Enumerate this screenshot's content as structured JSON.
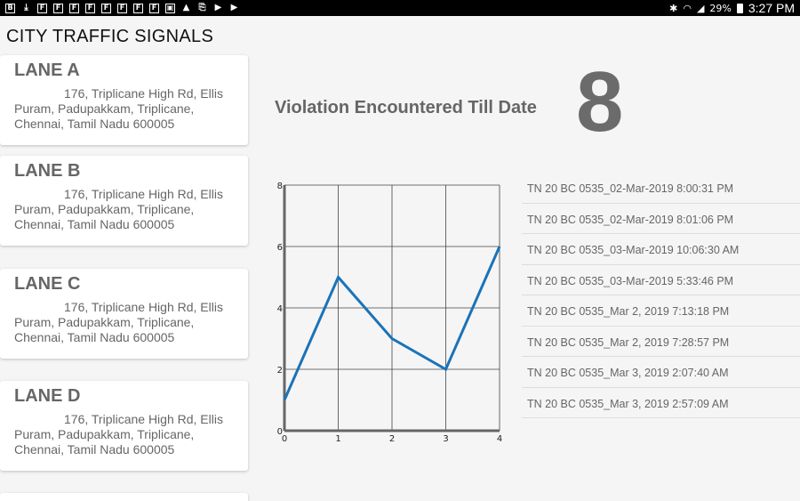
{
  "status_bar": {
    "notification_icons": [
      "b-icon",
      "download-icon",
      "f-icon",
      "f-icon",
      "f-icon",
      "f-icon",
      "f-icon",
      "f-icon",
      "f-icon",
      "f-icon",
      "image-icon",
      "drive-icon",
      "file-x-icon",
      "play-store-icon",
      "play-store-icon"
    ],
    "battery": "29%",
    "time": "3:27 PM"
  },
  "app": {
    "title": "CITY TRAFFIC SIGNALS"
  },
  "lanes": [
    {
      "name": "LANE A",
      "address": "176, Triplicane High Rd, Ellis Puram, Padupakkam, Triplicane, Chennai, Tamil Nadu 600005"
    },
    {
      "name": "LANE B",
      "address": "176, Triplicane High Rd, Ellis Puram, Padupakkam, Triplicane, Chennai, Tamil Nadu 600005"
    },
    {
      "name": "LANE C",
      "address": "176, Triplicane High Rd, Ellis Puram, Padupakkam, Triplicane, Chennai, Tamil Nadu 600005"
    },
    {
      "name": "LANE D",
      "address": "176, Triplicane High Rd, Ellis Puram, Padupakkam, Triplicane, Chennai, Tamil Nadu 600005"
    }
  ],
  "violation": {
    "label": "Violation Encountered Till Date",
    "count": "8"
  },
  "chart_data": {
    "type": "line",
    "x": [
      0,
      1,
      2,
      3,
      4
    ],
    "y": [
      1,
      5,
      3,
      2,
      6
    ],
    "xlim": [
      0,
      4
    ],
    "ylim": [
      0,
      8
    ],
    "x_ticks": [
      "0",
      "1",
      "2",
      "3",
      "4"
    ],
    "y_ticks": [
      "0",
      "2",
      "4",
      "6",
      "8"
    ],
    "grid": true,
    "color": "#1a73b8"
  },
  "records": [
    "TN 20 BC 0535_02-Mar-2019 8:00:31 PM",
    "TN 20 BC 0535_02-Mar-2019 8:01:06 PM",
    "TN 20 BC 0535_03-Mar-2019 10:06:30 AM",
    "TN 20 BC 0535_03-Mar-2019 5:33:46 PM",
    "TN 20 BC 0535_Mar 2, 2019 7:13:18 PM",
    "TN 20 BC 0535_Mar 2, 2019 7:28:57 PM",
    "TN 20 BC 0535_Mar 3, 2019 2:07:40 AM",
    "TN 20 BC 0535_Mar 3, 2019 2:57:09 AM"
  ]
}
